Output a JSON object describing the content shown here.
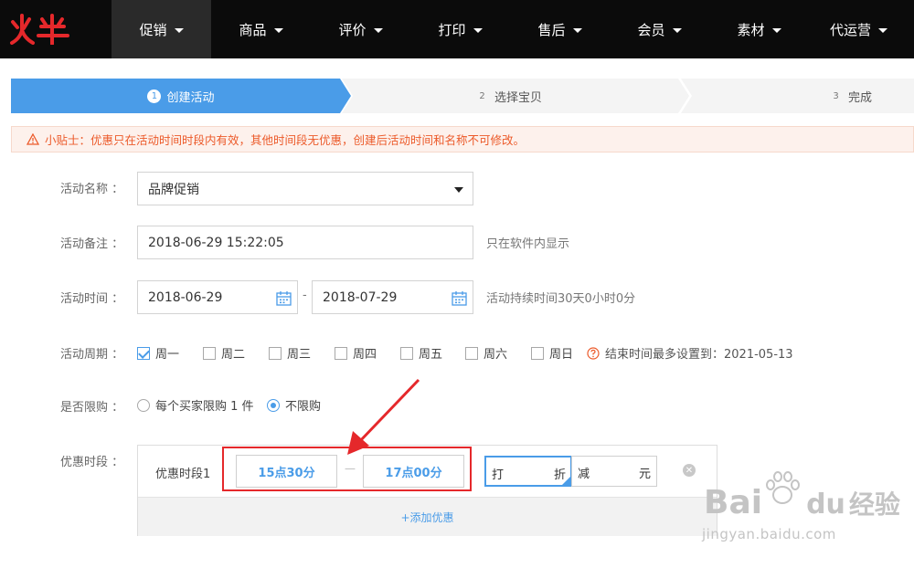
{
  "brand": {
    "logo_text": "火牛",
    "logo_color": "#e5282b"
  },
  "nav": {
    "items": [
      {
        "label": "促销",
        "active": true
      },
      {
        "label": "商品"
      },
      {
        "label": "评价"
      },
      {
        "label": "打印"
      },
      {
        "label": "售后"
      },
      {
        "label": "会员"
      },
      {
        "label": "素材"
      },
      {
        "label": "代运营"
      }
    ]
  },
  "steps": [
    {
      "num": "1",
      "label": "创建活动",
      "active": true
    },
    {
      "num": "2",
      "label": "选择宝贝"
    },
    {
      "num": "3",
      "label": "完成"
    }
  ],
  "tip": {
    "text": "小贴士：优惠只在活动时间时段内有效，其他时间段无优惠，创建后活动时间和名称不可修改。"
  },
  "form": {
    "name": {
      "label": "活动名称 ：",
      "value": "品牌促销"
    },
    "note": {
      "label": "活动备注 ：",
      "value": "2018-06-29 15:22:05",
      "hint": "只在软件内显示"
    },
    "time": {
      "label": "活动时间 ：",
      "start": "2018-06-29",
      "end": "2018-07-29",
      "dash": "-",
      "hint": "活动持续时间30天0小时0分"
    },
    "cycle": {
      "label": "活动周期 ：",
      "days": [
        {
          "label": "周一",
          "checked": true
        },
        {
          "label": "周二",
          "checked": false
        },
        {
          "label": "周三",
          "checked": false
        },
        {
          "label": "周四",
          "checked": false
        },
        {
          "label": "周五",
          "checked": false
        },
        {
          "label": "周六",
          "checked": false
        },
        {
          "label": "周日",
          "checked": false
        }
      ],
      "hint": "结束时间最多设置到：2021-05-13"
    },
    "limit": {
      "label": "是否限购 ：",
      "options": [
        {
          "label": "每个买家限购 1 件",
          "selected": false
        },
        {
          "label": "不限购",
          "selected": true
        }
      ]
    },
    "period": {
      "label": "优惠时段 ：",
      "row_label": "优惠时段1",
      "start": "15点30分",
      "sep": "—",
      "end": "17点00分",
      "discount_prefix": "打",
      "discount_suffix": "折",
      "reduce_prefix": "减",
      "reduce_suffix": "元",
      "add_label": "+添加优惠"
    }
  },
  "watermark": {
    "main": "Bai",
    "mid": "du",
    "cn": "经验",
    "url": "jingyan.baidu.com"
  },
  "colors": {
    "accent": "#4a9ce8",
    "warning": "#ec5a2a",
    "highlight": "#e5282b"
  }
}
